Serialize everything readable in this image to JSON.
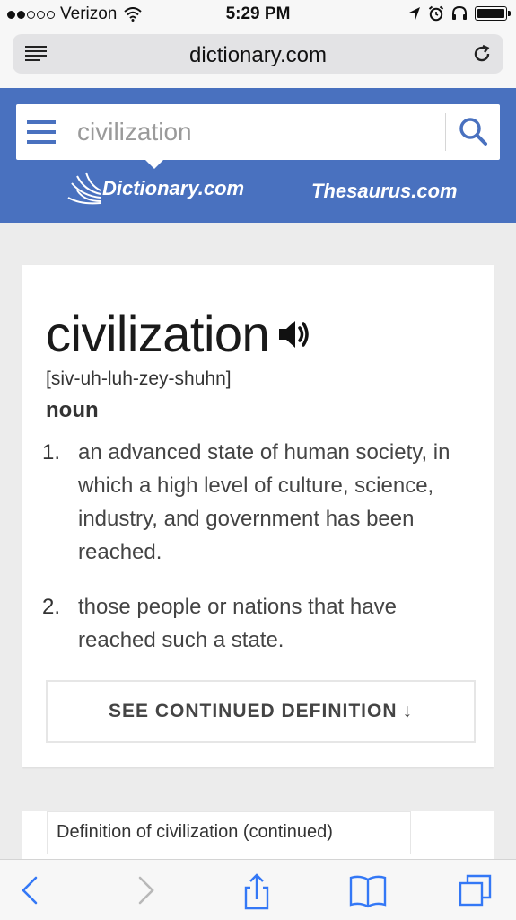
{
  "status_bar": {
    "carrier": "Verizon",
    "time": "5:29 PM",
    "signal_bars": "2 of 5",
    "battery_level": 1.0
  },
  "browser": {
    "url": "dictionary.com",
    "icons": {
      "reader": "reader-view-icon",
      "reload": "reload-icon"
    }
  },
  "header": {
    "search_value": "civilization",
    "search_placeholder": "civilization",
    "brand_dictionary": "Dictionary.com",
    "brand_thesaurus": "Thesaurus.com",
    "accent_color": "#4971bf"
  },
  "entry": {
    "headword": "civilization",
    "pronunciation": "[siv-uh-luh-zey-shuhn]",
    "part_of_speech": "noun",
    "definitions": [
      {
        "num": "1.",
        "text": "an advanced state of human society, in which a high level of culture, science, industry, and government has been reached."
      },
      {
        "num": "2.",
        "text": "those people or nations that have reached such a state."
      }
    ],
    "continued_label": "SEE CONTINUED DEFINITION",
    "continued_arrow": "↓"
  },
  "continued_card": {
    "label": "Definition of civilization (continued)"
  },
  "toolbar": {
    "icons": [
      "back-icon",
      "forward-icon",
      "share-icon",
      "bookmarks-icon",
      "tabs-icon"
    ]
  }
}
